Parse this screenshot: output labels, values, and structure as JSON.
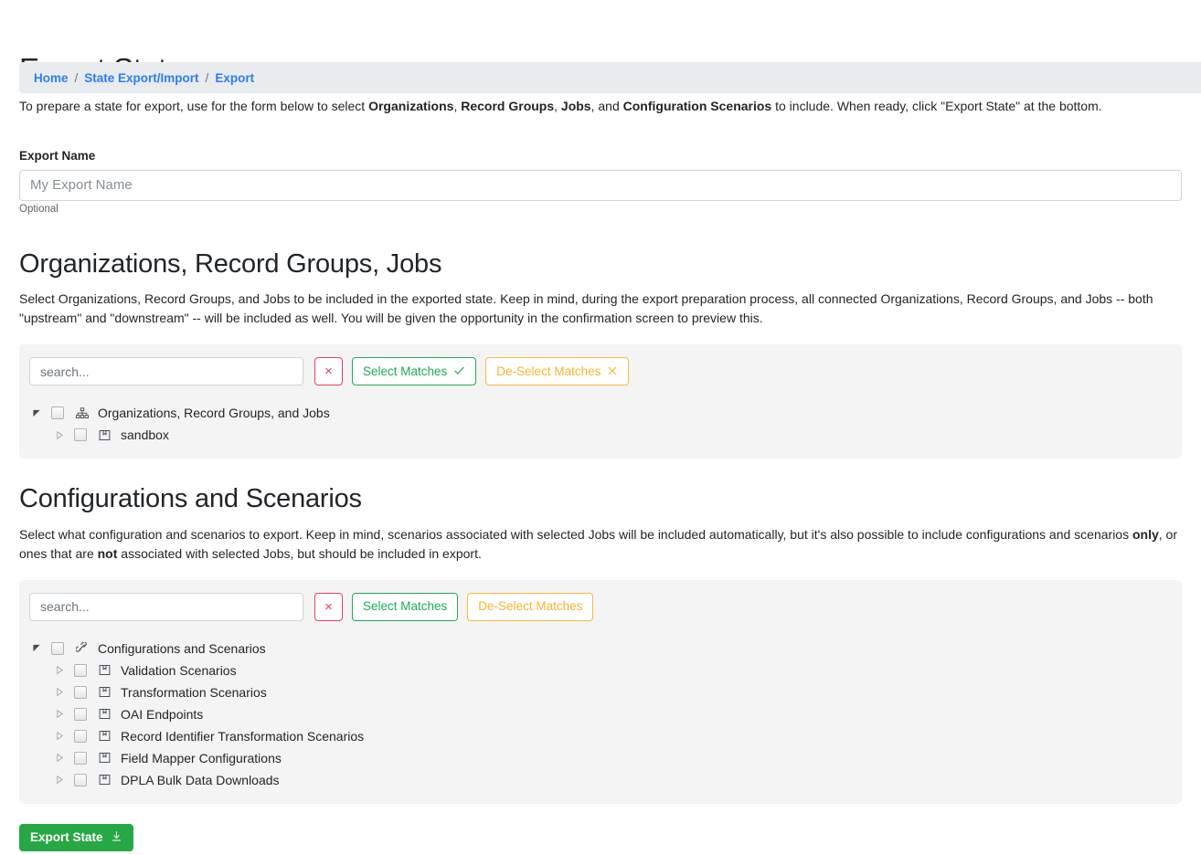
{
  "breadcrumb": {
    "items": [
      {
        "label": "Home"
      },
      {
        "label": "State Export/Import"
      },
      {
        "label": "Export"
      }
    ],
    "separator": "/"
  },
  "page": {
    "title": "Export State",
    "intro_1": "To prepare a state for export, use for the form below to select ",
    "intro_b1": "Organizations",
    "intro_2": ", ",
    "intro_b2": "Record Groups",
    "intro_3": ", ",
    "intro_b3": "Jobs",
    "intro_4": ", and ",
    "intro_b4": "Configuration Scenarios",
    "intro_5": " to include. When ready, click \"Export State\" at the bottom."
  },
  "export_name": {
    "label": "Export Name",
    "value": "",
    "placeholder": "My Export Name",
    "help": "Optional"
  },
  "orgs_section": {
    "title": "Organizations, Record Groups, Jobs",
    "description": "Select Organizations, Record Groups, and Jobs to be included in the exported state. Keep in mind, during the export preparation process, all connected Organizations, Record Groups, and Jobs -- both \"upstream\" and \"downstream\" -- will be included as well. You will be given the opportunity in the confirmation screen to preview this.",
    "toolbar": {
      "search_value": "",
      "search_placeholder": "search...",
      "clear_label": "×",
      "clear_icon": "times-icon",
      "select_label": "Select Matches",
      "select_icon": "check-icon",
      "deselect_label": "De-Select Matches",
      "deselect_icon": "times-icon"
    },
    "tree": [
      {
        "label": "Organizations, Record Groups, and Jobs",
        "icon": "sitemap-icon",
        "twisty": "expanded",
        "checked": false,
        "depth": 0
      },
      {
        "label": "sandbox",
        "icon": "archive-icon",
        "twisty": "collapsed",
        "checked": false,
        "depth": 1
      }
    ]
  },
  "config_section": {
    "title": "Configurations and Scenarios",
    "desc_1": "Select what configuration and scenarios to export. Keep in mind, scenarios associated with selected Jobs will be included automatically, but it's also possible to include configurations and scenarios ",
    "desc_b1": "only",
    "desc_2": ", or ones that are ",
    "desc_b2": "not",
    "desc_3": " associated with selected Jobs, but should be included in export.",
    "toolbar": {
      "search_value": "",
      "search_placeholder": "search...",
      "clear_label": "×",
      "clear_icon": "times-icon",
      "select_label": "Select Matches",
      "deselect_label": "De-Select Matches"
    },
    "tree": [
      {
        "label": "Configurations and Scenarios",
        "icon": "link-icon",
        "twisty": "expanded",
        "checked": false,
        "depth": 0
      },
      {
        "label": "Validation Scenarios",
        "icon": "archive-icon",
        "twisty": "collapsed",
        "checked": false,
        "depth": 1
      },
      {
        "label": "Transformation Scenarios",
        "icon": "archive-icon",
        "twisty": "collapsed",
        "checked": false,
        "depth": 1
      },
      {
        "label": "OAI Endpoints",
        "icon": "archive-icon",
        "twisty": "collapsed",
        "checked": false,
        "depth": 1
      },
      {
        "label": "Record Identifier Transformation Scenarios",
        "icon": "archive-icon",
        "twisty": "collapsed",
        "checked": false,
        "depth": 1
      },
      {
        "label": "Field Mapper Configurations",
        "icon": "archive-icon",
        "twisty": "collapsed",
        "checked": false,
        "depth": 1
      },
      {
        "label": "DPLA Bulk Data Downloads",
        "icon": "archive-icon",
        "twisty": "collapsed",
        "checked": false,
        "depth": 1
      }
    ]
  },
  "submit": {
    "label": "Export State",
    "icon": "download-icon"
  },
  "colors": {
    "link": "#2f7bf6",
    "breadcrumb_bg": "#e9ecef",
    "panel_bg": "#f4f4f4",
    "danger": "#e4405f",
    "success": "#21a957",
    "warning": "#f2b633",
    "submit_green": "#28a745"
  }
}
